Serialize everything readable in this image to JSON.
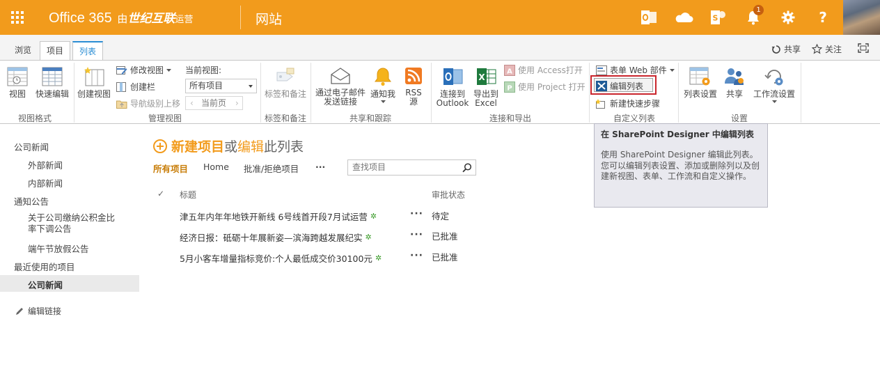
{
  "suite": {
    "brand_prefix": "Office 365 ",
    "brand_by": "由",
    "brand_company": "世纪互联",
    "brand_operator": "运营",
    "site_label": "网站",
    "notification_count": "1",
    "colors": {
      "suite_bg": "#f29b1c",
      "accent_blue": "#2a8dd4",
      "highlight_red": "#c9252c"
    }
  },
  "tabs": [
    {
      "label": "浏览"
    },
    {
      "label": "项目"
    },
    {
      "label": "列表"
    }
  ],
  "tabrow_actions": {
    "share": "共享",
    "follow": "关注"
  },
  "ribbon": {
    "groups": {
      "view_format": "视图格式",
      "manage_views": "管理视图",
      "tags_notes": "标签和备注",
      "share_track": "共享和跟踪",
      "connect_export": "连接和导出",
      "customize_list": "自定义列表",
      "settings": "设置"
    },
    "buttons": {
      "view": "视图",
      "quick_edit": "快速编辑",
      "create_view": "创建视图",
      "modify_view": "修改视图",
      "create_column": "创建栏",
      "navigate_up": "导航级别上移",
      "current_view_label": "当前视图:",
      "current_view_value": "所有项目",
      "current_page": "当前页",
      "tags_notes": "标签和备注",
      "email_link_line1": "通过电子邮件",
      "email_link_line2": "发送链接",
      "alert_me": "通知我",
      "rss_line1": "RSS",
      "rss_line2": "源",
      "connect_line1": "连接到",
      "connect_line2": "Outlook",
      "export_line1": "导出到",
      "export_line2": "Excel",
      "open_access": "使用 Access打开",
      "open_project": "使用 Project 打开",
      "form_web_parts": "表单 Web 部件",
      "edit_list": "编辑列表",
      "new_quick_step": "新建快速步骤",
      "list_settings": "列表设置",
      "share": "共享",
      "workflow_settings": "工作流设置"
    }
  },
  "tooltip": {
    "title": "在 SharePoint Designer 中编辑列表",
    "line1": "使用 SharePoint Designer 编辑此列表。",
    "line2": "您可以编辑列表设置、添加或删除列以及创建新视图、表单、工作流和自定义操作。"
  },
  "left_nav": {
    "company_news": "公司新闻",
    "external_news": "外部新闻",
    "internal_news": "内部新闻",
    "announcements": "通知公告",
    "housing_fund_line1": "关于公司缴纳公积金比",
    "housing_fund_line2": "率下调公告",
    "dragon_boat": "端午节放假公告",
    "recent": "最近使用的项目",
    "recent_company_news": "公司新闻",
    "edit_links": "编辑链接"
  },
  "main": {
    "heading_new": "新建项目",
    "heading_or": "或",
    "heading_edit": "编辑",
    "heading_rest": "此列表",
    "views": [
      "所有项目",
      "Home",
      "批准/拒绝项目"
    ],
    "more_views": "···",
    "search_placeholder": "查找项目",
    "columns": {
      "check": "✓",
      "title": "标题",
      "status": "审批状态"
    },
    "rows": [
      {
        "title": "津五年内年年地铁开新线 6号线首开段7月试运营",
        "status": "待定"
      },
      {
        "title": "经济日报：砥砺十年展新姿—滨海跨越发展纪实",
        "status": "已批准"
      },
      {
        "title": "5月小客车增量指标竞价:个人最低成交价30100元",
        "status": "已批准"
      }
    ],
    "row_more": "···"
  }
}
